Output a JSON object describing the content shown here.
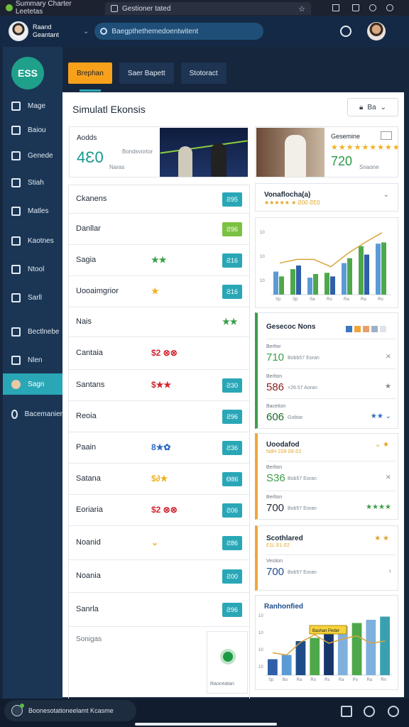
{
  "browser": {
    "tab1_title": "Summary Charter Leetetas",
    "tab2_url": "Gestioner tated"
  },
  "header": {
    "user_line1": "Raand",
    "user_line2": "Geantant",
    "search_placeholder": "Baegpthethemedoentwitent"
  },
  "sidebar": {
    "logo": "ESS",
    "items": [
      {
        "label": "Mage"
      },
      {
        "label": "Baiou"
      },
      {
        "label": "Genede"
      },
      {
        "label": "Stiah"
      },
      {
        "label": "Matles"
      },
      {
        "label": "Kaotnes"
      },
      {
        "label": "Ntool"
      },
      {
        "label": "Sarll"
      },
      {
        "label": "Bectlnebe"
      },
      {
        "label": "Nlen"
      },
      {
        "label": "Sagn"
      },
      {
        "label": "Bacemanier"
      }
    ]
  },
  "toolbar": {
    "tabs": [
      {
        "label": "Brephan"
      },
      {
        "label": "Saer Bapett"
      },
      {
        "label": "Stotoract"
      }
    ]
  },
  "main": {
    "title": "Simulatl Ekonsis",
    "filter_label": "Ba",
    "kpi1": {
      "label": "Aodds",
      "value": "4Ɛ0",
      "sub1": "Bondsvortor",
      "sub2": "Naras"
    },
    "kpi2": {
      "label": "Gesemine",
      "stars": "★★★★★★★★★",
      "value": "720",
      "sub": "Snaone"
    },
    "list": [
      {
        "name": "Ckanens",
        "stars": "",
        "badge": "Ƨ95",
        "badge_color": "#2aa7b7"
      },
      {
        "name": "Danllar",
        "stars": "",
        "badge": "Ƨ96",
        "badge_color": "#7cc242"
      },
      {
        "name": "Sagia",
        "stars": "★★",
        "star_color": "#3c9e48",
        "badge": "Ƨ16",
        "badge_color": "#2aa7b7"
      },
      {
        "name": "Uooaimgrior",
        "stars": "★",
        "star_color": "#f0b21d",
        "badge": "Ƨ16",
        "badge_color": "#2aa7b7"
      },
      {
        "name": "Nais",
        "stars": "★★",
        "star_color": "#3c9e48",
        "badge": "",
        "badge_color": ""
      },
      {
        "name": "Cantaia",
        "stars": "$2 ⊗⊗",
        "star_color": "#d3232e",
        "badge": "",
        "badge_color": ""
      },
      {
        "name": "Santans",
        "stars": "$★★",
        "star_color": "#d3232e",
        "badge": "Ƨ30",
        "badge_color": "#2aa7b7"
      },
      {
        "name": "Reoia",
        "stars": "",
        "badge": "Ƨ96",
        "badge_color": "#2aa7b7"
      },
      {
        "name": "Paain",
        "stars": "8★✿",
        "star_color": "#2d6bc4",
        "badge": "Ƨ36",
        "badge_color": "#2aa7b7"
      },
      {
        "name": "Satana",
        "stars": "$∂★",
        "star_color": "#f0b21d",
        "badge": "Ɵ86",
        "badge_color": "#2aa7b7"
      },
      {
        "name": "Eoriaria",
        "stars": "$2 ⊗⊗",
        "star_color": "#d3232e",
        "badge": "Ƨ06",
        "badge_color": "#2aa7b7"
      },
      {
        "name": "Noanid",
        "stars": "⌄",
        "star_color": "#f0b21d",
        "badge": "Ƨ86",
        "badge_color": "#2aa7b7"
      },
      {
        "name": "Noania",
        "stars": "",
        "badge": "Ƨ00",
        "badge_color": "#2aa7b7"
      },
      {
        "name": "Sanrla",
        "stars": "",
        "badge": "Ƨ96",
        "badge_color": "#2aa7b7"
      }
    ],
    "list_footer_label": "Sonigas",
    "list_footer_box": "Raoceatan"
  },
  "right": {
    "rating": {
      "title": "Vonaflocha(a)",
      "sub": "★★★★★ ★ Ƨ00 ƧƐ0"
    },
    "metricsA": {
      "title": "Gesecoc Nons",
      "swatches": [
        "#3a78c2",
        "#f0a63a",
        "#e6a06a",
        "#9fb0c6",
        "#dfe4ea"
      ],
      "rows": [
        {
          "label": "Berltor",
          "value": "710",
          "sub": "Bobb57 Eoran",
          "value_color": "#3c9e48"
        },
        {
          "label": "Berlton",
          "value": "586",
          "sub": "+26.57 Aoran",
          "value_color": "#8c1c1c"
        },
        {
          "label": "Bacetion",
          "value": "606",
          "sub": "Gobtar",
          "value_color": "#1e6b2b"
        }
      ]
    },
    "metricsB": {
      "title": "Uoodafod",
      "sub": "NdH 1S9 Ƨ8 Ƨ2",
      "rows": [
        {
          "label": "Berlton",
          "value": "S36",
          "sub": "Bob57 Eoran",
          "value_color": "#3c9e48"
        },
        {
          "label": "Berlton",
          "value": "700",
          "sub": "Bob57 Eoran",
          "value_color": "#1e2a38"
        }
      ]
    },
    "metricsC": {
      "title": "Scothlared",
      "sub": "Ɛ1L Ƨ1 Ƨ2",
      "rows": [
        {
          "label": "Vestion",
          "value": "700",
          "sub": "Bob57 Eoran",
          "value_color": "#1e4c8a"
        }
      ]
    },
    "bars2_title": "Ranhonfied",
    "bars2_callout": "Bashan Peder"
  },
  "chart_data": [
    {
      "type": "bar",
      "categories": [
        "Sp",
        "Sp",
        "Sa",
        "Ro",
        "Ra",
        "Ra",
        "Ro"
      ],
      "series": [
        {
          "values": [
            38,
            42,
            28,
            36,
            52,
            80,
            84
          ]
        },
        {
          "values": [
            30,
            48,
            34,
            30,
            60,
            66,
            86
          ]
        }
      ],
      "line": [
        52,
        58,
        58,
        46,
        68,
        86,
        102
      ],
      "ylim": [
        0,
        110
      ],
      "yticks": [
        "10",
        "10",
        "10"
      ]
    },
    {
      "type": "bar",
      "categories": [
        "Sp",
        "Bo",
        "Ra",
        "Ro",
        "Rs",
        "Ra",
        "Po",
        "Ra",
        "Rn"
      ],
      "values": [
        30,
        38,
        64,
        70,
        82,
        92,
        98,
        104,
        110
      ],
      "line": [
        42,
        38,
        62,
        76,
        60,
        68,
        74,
        60,
        64
      ],
      "ylim": [
        0,
        120
      ],
      "yticks": [
        "10",
        "10",
        "10",
        "10"
      ]
    }
  ],
  "bottombar": {
    "pill_text": "Boonesotationeelamt Kcasme"
  }
}
